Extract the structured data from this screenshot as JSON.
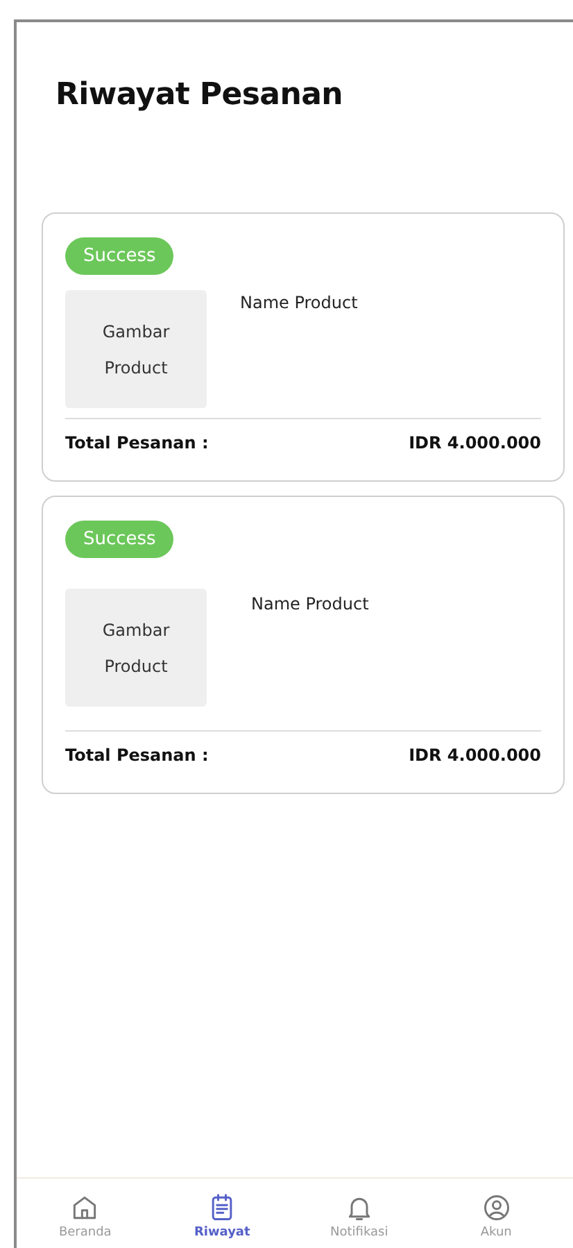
{
  "title": "Riwayat Pesanan",
  "orders": [
    {
      "status": "Success",
      "image_label": "Gambar Product",
      "product_name": "Name Product",
      "total_label": "Total Pesanan :",
      "total": "IDR 4.000.000"
    },
    {
      "status": "Success",
      "image_label": "Gambar Product",
      "product_name": "Name Product",
      "total_label": "Total Pesanan :",
      "total": "IDR 4.000.000"
    }
  ],
  "nav": [
    {
      "kind": "home",
      "label": "Beranda",
      "selected": false
    },
    {
      "kind": "history",
      "label": "Riwayat",
      "selected": true
    },
    {
      "kind": "bell",
      "label": "Notifikasi",
      "selected": false
    },
    {
      "kind": "account",
      "label": "Akun",
      "selected": false
    }
  ]
}
